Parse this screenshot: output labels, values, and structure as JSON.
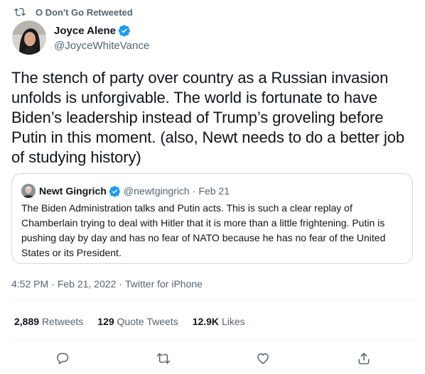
{
  "retweet_notice": {
    "text": "O Don't Go Retweeted",
    "icon": "retweet-icon"
  },
  "author": {
    "name": "Joyce Alene",
    "handle": "@JoyceWhiteVance",
    "verified": true
  },
  "tweet": {
    "text": "The stench of party over country as a Russian invasion unfolds is unforgivable. The world is fortunate to have Biden’s leadership instead of Trump’s groveling before Putin in this moment. (also, Newt needs to do a better job of studying history)"
  },
  "quoted_tweet": {
    "name": "Newt Gingrich",
    "handle": "@newtgingrich",
    "separator": "·",
    "date": "Feb 21",
    "verified": true,
    "text": "The Biden Administration talks and Putin acts. This is such a clear replay of Chamberlain trying to deal with Hitler that it is more than a little frightening. Putin is pushing day by day and has no fear of NATO because he has no fear of the United States or its President."
  },
  "meta": {
    "time": "4:52 PM",
    "date": "Feb 21, 2022",
    "source": "Twitter for iPhone",
    "separator": "·"
  },
  "stats": {
    "retweets_count": "2,889",
    "retweets_label": "Retweets",
    "quotes_count": "129",
    "quotes_label": "Quote Tweets",
    "likes_count": "12.9K",
    "likes_label": "Likes"
  },
  "actions": [
    "reply-icon",
    "retweet-icon",
    "like-icon",
    "share-icon"
  ],
  "colors": {
    "text": "#0f1419",
    "secondary": "#536471",
    "verified": "#1d9bf0",
    "border": "#cfd9de",
    "divider": "#eff3f4"
  }
}
